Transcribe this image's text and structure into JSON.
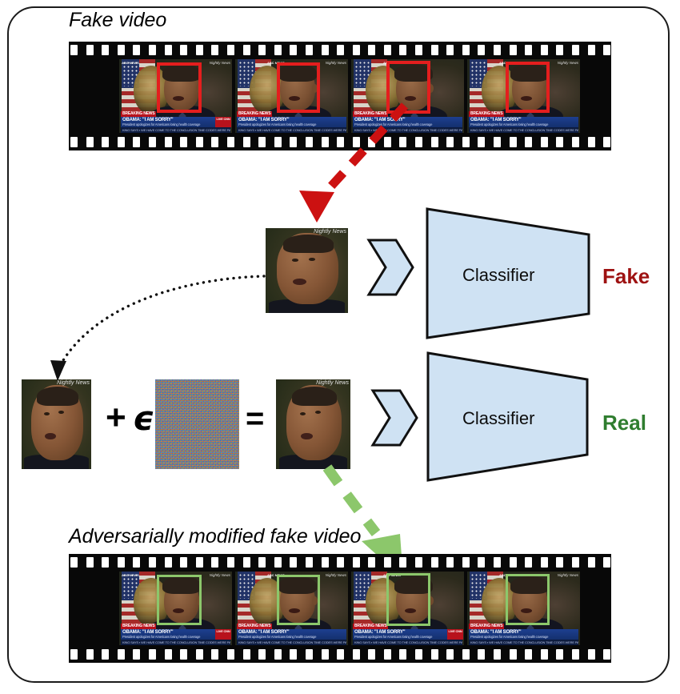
{
  "figure": {
    "title_top": "Fake video",
    "title_bottom": "Adversarially modified fake video"
  },
  "pipeline": {
    "classifier_label_top": "Classifier",
    "classifier_label_bottom": "Classifier",
    "verdict_top": "Fake",
    "verdict_bottom": "Real",
    "verdict_top_color": "#9e1212",
    "verdict_bottom_color": "#2f7d2f",
    "classifier_fill": "#cfe2f3",
    "classifier_stroke": "#111111",
    "chevron_fill": "#cfe2f3",
    "chevron_stroke": "#111111"
  },
  "math": {
    "plus": "+",
    "epsilon": "ϵ",
    "equals": "="
  },
  "arrows": {
    "fake_extract": {
      "style": "dashed",
      "color": "#cc1111",
      "label": "frame extracted from fake video"
    },
    "feedback": {
      "style": "dotted",
      "color": "#111111",
      "label": "face image reused as adversarial input"
    },
    "reinsert": {
      "style": "dashed",
      "color": "#8cc76b",
      "label": "adversarial frame inserted back into video"
    }
  },
  "news_frame": {
    "breaking_text": "BREAKING NEWS",
    "headline": "OBAMA: \"I AM SORRY\"",
    "subhead": "President apologizes for Americans losing health coverage",
    "ticker": "KING SAYS  ▪  WE HAVE COME TO THE CONCLUSION TIME CODES WERE PART OF THE VIDEO, BUT WERE EITHER",
    "logo": "LIVE CNN",
    "corner_watermark": "Nightly News",
    "network": "ABC NEWS",
    "network_sub": "BREAKING"
  },
  "filmstrips": {
    "top": {
      "name": "fake-video-filmstrip",
      "frame_count": 4,
      "detection_box_color": "#e41e1e"
    },
    "bottom": {
      "name": "adversarial-video-filmstrip",
      "frame_count": 4,
      "detection_box_color": "#8cc76b"
    }
  },
  "face_crops": {
    "extracted": "extracted-face-crop",
    "clean_input": "clean-face-input",
    "perturbed": "perturbed-face-output",
    "noise_patch": "adversarial-noise-patch"
  }
}
